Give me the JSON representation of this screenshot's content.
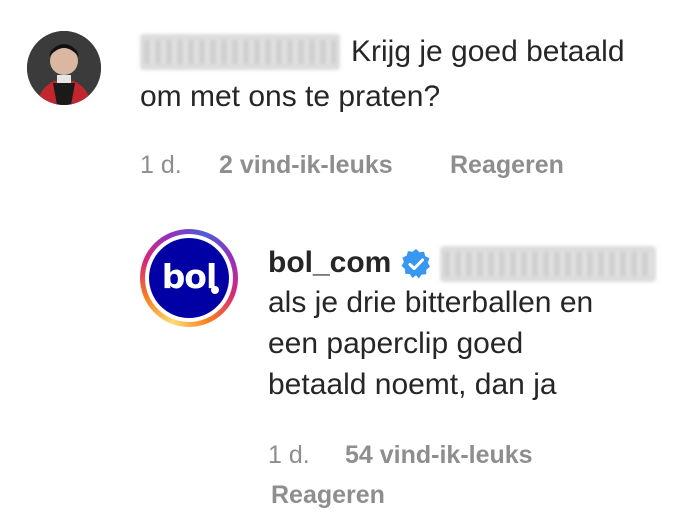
{
  "comment": {
    "text_line1": "Krijg je goed betaald",
    "text_line2": "om met ons te praten?",
    "time": "1 d.",
    "likes": "2 vind-ik-leuks",
    "reply": "Reageren"
  },
  "reply_comment": {
    "username": "bol_com",
    "verified": true,
    "avatar_text": "bol",
    "text_line1": "als je drie bitterballen en",
    "text_line2": "een paperclip goed",
    "text_line3": "betaald noemt, dan ja",
    "time": "1 d.",
    "likes": "54 vind-ik-leuks",
    "reply": "Reageren"
  },
  "colors": {
    "text": "#262626",
    "meta": "#8e8e8e",
    "verified_badge": "#3897f0",
    "bol_brand": "#0000a4"
  }
}
